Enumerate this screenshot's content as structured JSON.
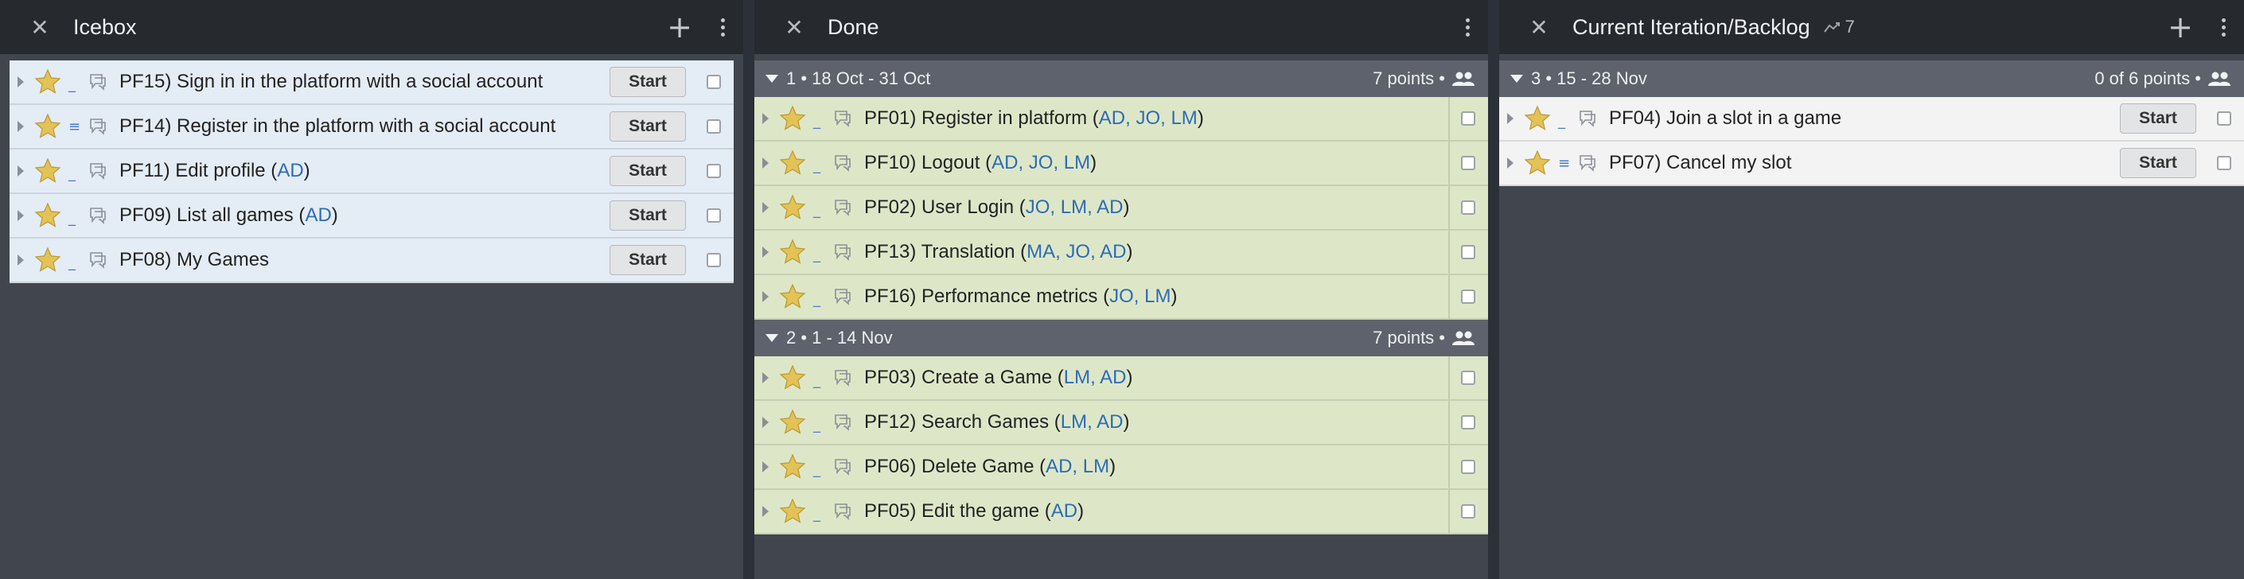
{
  "icebox": {
    "title": "Icebox",
    "stories": [
      {
        "id_title": "PF15) Sign in in the platform with a social account",
        "owners": "",
        "estimate": "none"
      },
      {
        "id_title": "PF14) Register in the platform with a social account",
        "owners": "",
        "estimate": "lines"
      },
      {
        "id_title": "PF11) Edit profile",
        "owners": "AD",
        "estimate": "none"
      },
      {
        "id_title": "PF09) List all games",
        "owners": "AD",
        "estimate": "none"
      },
      {
        "id_title": "PF08) My Games",
        "owners": "",
        "estimate": "none"
      }
    ],
    "start_label": "Start"
  },
  "done": {
    "title": "Done",
    "iterations": [
      {
        "label": "1 • 18 Oct - 31 Oct",
        "points": "7 points •",
        "stories": [
          {
            "id_title": "PF01) Register in platform",
            "owners": "AD, JO, LM"
          },
          {
            "id_title": "PF10) Logout",
            "owners": "AD, JO, LM"
          },
          {
            "id_title": "PF02) User Login",
            "owners": "JO, LM, AD"
          },
          {
            "id_title": "PF13) Translation",
            "owners": "MA, JO, AD"
          },
          {
            "id_title": "PF16) Performance metrics",
            "owners": "JO, LM"
          }
        ]
      },
      {
        "label": "2 • 1 - 14 Nov",
        "points": "7 points •",
        "stories": [
          {
            "id_title": "PF03) Create a Game",
            "owners": "LM, AD"
          },
          {
            "id_title": "PF12) Search Games",
            "owners": "LM, AD"
          },
          {
            "id_title": "PF06) Delete Game",
            "owners": "AD, LM"
          },
          {
            "id_title": "PF05) Edit the game",
            "owners": "AD"
          }
        ]
      }
    ]
  },
  "current": {
    "title": "Current Iteration/Backlog",
    "velocity": "7",
    "iteration": {
      "label": "3 • 15 - 28 Nov",
      "points": "0 of 6 points •"
    },
    "stories": [
      {
        "id_title": "PF04) Join a slot in a game",
        "owners": "",
        "estimate": "none"
      },
      {
        "id_title": "PF07) Cancel my slot",
        "owners": "",
        "estimate": "lines"
      }
    ],
    "start_label": "Start"
  },
  "icons": {
    "close": "close-icon",
    "add": "plus-icon",
    "menu": "kebab-menu-icon",
    "star": "star-icon",
    "comment": "comment-icon",
    "people": "people-icon",
    "velocity": "velocity-icon"
  },
  "colors": {
    "header_bg": "#26292e",
    "panel_bg": "#40454e",
    "icebox_row": "#e4ecf5",
    "done_row": "#dde7c8",
    "current_row": "#f3f3f3",
    "owner_link": "#2f6bb3",
    "star": "#e0c25a"
  }
}
